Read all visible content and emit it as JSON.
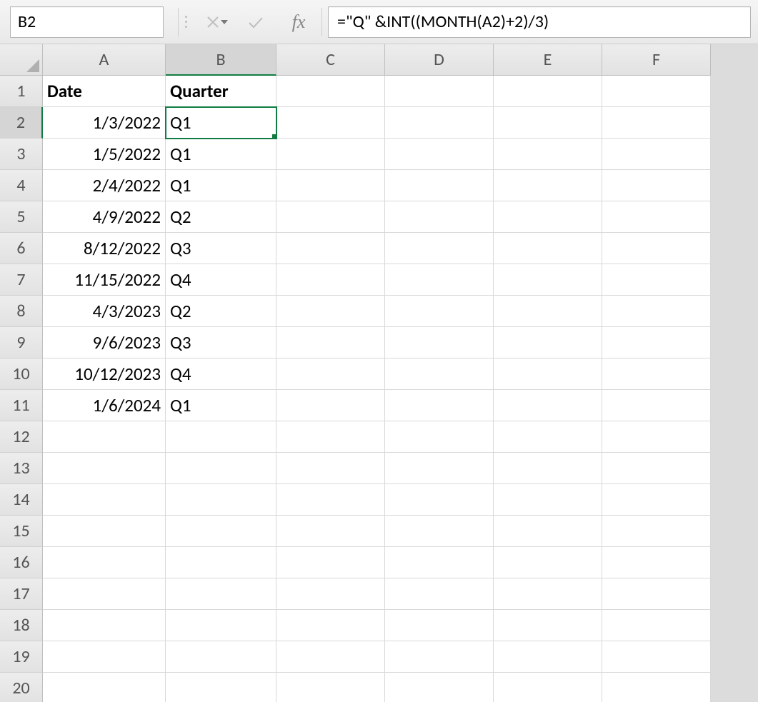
{
  "name_box": {
    "value": "B2"
  },
  "formula_bar": {
    "value": "=\"Q\" &INT((MONTH(A2)+2)/3)",
    "fx_label": "fx"
  },
  "columns": [
    "A",
    "B",
    "C",
    "D",
    "E",
    "F"
  ],
  "rows": [
    1,
    2,
    3,
    4,
    5,
    6,
    7,
    8,
    9,
    10,
    11,
    12,
    13,
    14,
    15,
    16,
    17,
    18,
    19,
    20
  ],
  "selected": {
    "col": "B",
    "row": 2
  },
  "headers": {
    "A": "Date",
    "B": "Quarter"
  },
  "data": [
    {
      "date": "1/3/2022",
      "quarter": "Q1"
    },
    {
      "date": "1/5/2022",
      "quarter": "Q1"
    },
    {
      "date": "2/4/2022",
      "quarter": "Q1"
    },
    {
      "date": "4/9/2022",
      "quarter": "Q2"
    },
    {
      "date": "8/12/2022",
      "quarter": "Q3"
    },
    {
      "date": "11/15/2022",
      "quarter": "Q4"
    },
    {
      "date": "4/3/2023",
      "quarter": "Q2"
    },
    {
      "date": "9/6/2023",
      "quarter": "Q3"
    },
    {
      "date": "10/12/2023",
      "quarter": "Q4"
    },
    {
      "date": "1/6/2024",
      "quarter": "Q1"
    }
  ]
}
